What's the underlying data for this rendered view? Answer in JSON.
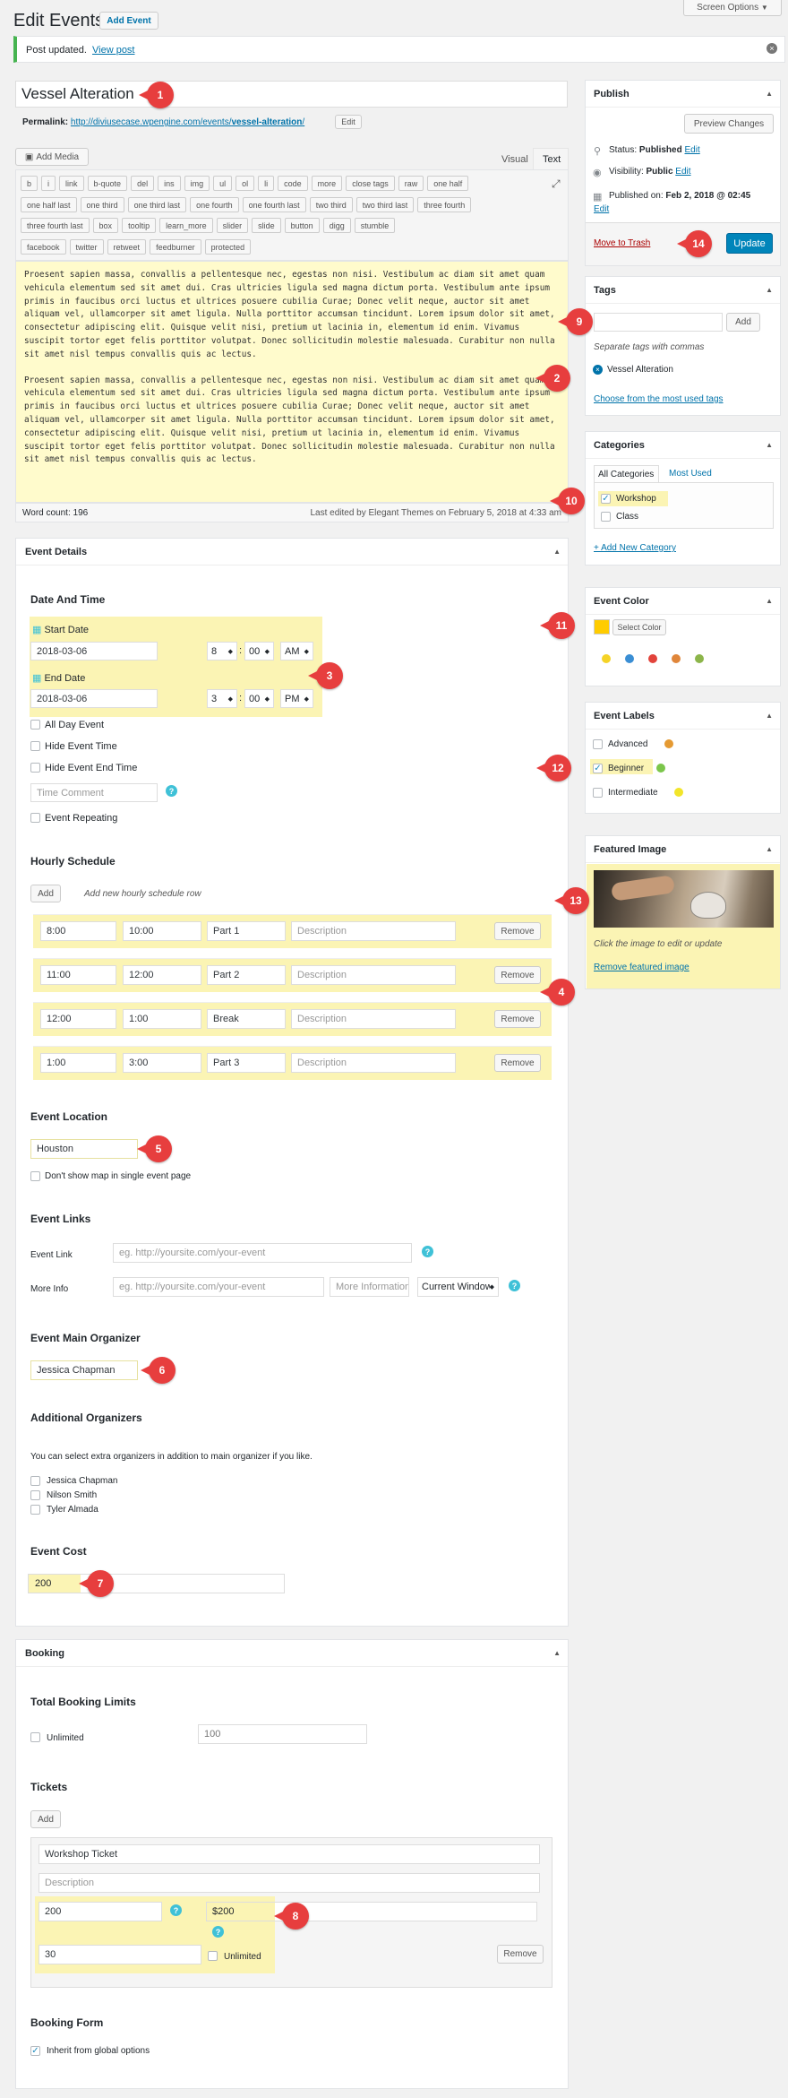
{
  "header": {
    "title": "Edit Events",
    "add_button": "Add Event",
    "screen_options": "Screen Options"
  },
  "notice": {
    "text": "Post updated.",
    "link": "View post"
  },
  "post": {
    "title": "Vessel Alteration",
    "permalink_label": "Permalink:",
    "permalink_base": "http://diviusecase.wpengine.com/events/",
    "permalink_slug": "vessel-alteration",
    "permalink_tail": "/",
    "edit": "Edit"
  },
  "editor": {
    "add_media": "Add Media",
    "tab_visual": "Visual",
    "tab_text": "Text",
    "qt_row1": [
      "b",
      "i",
      "link",
      "b-quote",
      "del",
      "ins",
      "img",
      "ul",
      "ol",
      "li",
      "code",
      "more",
      "close tags",
      "raw",
      "one half"
    ],
    "qt_row2": [
      "one half last",
      "one third",
      "one third last",
      "one fourth",
      "one fourth last",
      "two third",
      "two third last",
      "three fourth"
    ],
    "qt_row3": [
      "three fourth last",
      "box",
      "tooltip",
      "learn_more",
      "slider",
      "slide",
      "button",
      "digg",
      "stumble"
    ],
    "qt_row4": [
      "facebook",
      "twitter",
      "retweet",
      "feedburner",
      "protected"
    ],
    "para1": "Proesent sapien massa, convallis a pellentesque nec, egestas non nisi. Vestibulum ac diam sit amet quam vehicula elementum sed sit amet dui. Cras ultricies ligula sed magna dictum porta. Vestibulum ante ipsum primis in faucibus orci luctus et ultrices posuere cubilia Curae; Donec velit neque, auctor sit amet aliquam vel, ullamcorper sit amet ligula. Nulla porttitor accumsan tincidunt. Lorem ipsum dolor sit amet, consectetur adipiscing elit. Quisque velit nisi, pretium ut lacinia in, elementum id enim. Vivamus suscipit tortor eget felis porttitor volutpat. Donec sollicitudin molestie malesuada. Curabitur non nulla sit amet nisl tempus convallis quis ac lectus.",
    "para2": "Proesent sapien massa, convallis a pellentesque nec, egestas non nisi. Vestibulum ac diam sit amet quam vehicula elementum sed sit amet dui. Cras ultricies ligula sed magna dictum porta. Vestibulum ante ipsum primis in faucibus orci luctus et ultrices posuere cubilia Curae; Donec velit neque, auctor sit amet aliquam vel, ullamcorper sit amet ligula. Nulla porttitor accumsan tincidunt. Lorem ipsum dolor sit amet, consectetur adipiscing elit. Quisque velit nisi, pretium ut lacinia in, elementum id enim. Vivamus suscipit tortor eget felis porttitor volutpat. Donec sollicitudin molestie malesuada. Curabitur non nulla sit amet nisl tempus convallis quis ac lectus.",
    "word_count": "Word count: 196",
    "last_edited": "Last edited by Elegant Themes on February 5, 2018 at 4:33 am"
  },
  "event": {
    "title": "Event Details",
    "dt_heading": "Date And Time",
    "start_label": "Start Date",
    "start_date": "2018-03-06",
    "start_hour": "8",
    "start_min": "00",
    "start_ampm": "AM",
    "end_label": "End Date",
    "end_date": "2018-03-06",
    "end_hour": "3",
    "end_min": "00",
    "end_ampm": "PM",
    "colon": ":",
    "all_day": "All Day Event",
    "hide_time": "Hide Event Time",
    "hide_end": "Hide Event End Time",
    "time_comment": "Time Comment",
    "repeating": "Event Repeating",
    "help": "?"
  },
  "hourly": {
    "heading": "Hourly Schedule",
    "add": "Add",
    "hint": "Add new hourly schedule row",
    "desc_ph": "Description",
    "remove": "Remove",
    "rows": [
      {
        "from": "8:00",
        "to": "10:00",
        "title": "Part 1"
      },
      {
        "from": "11:00",
        "to": "12:00",
        "title": "Part 2"
      },
      {
        "from": "12:00",
        "to": "1:00",
        "title": "Break"
      },
      {
        "from": "1:00",
        "to": "3:00",
        "title": "Part 3"
      }
    ]
  },
  "location": {
    "heading": "Event Location",
    "value": "Houston",
    "no_map": "Don't show map in single event page"
  },
  "links": {
    "heading": "Event Links",
    "link_label": "Event Link",
    "link_ph": "eg. http://yoursite.com/your-event",
    "more_label": "More Info",
    "more_ph": "eg. http://yoursite.com/your-event",
    "more_text_ph": "More Information",
    "target": "Current Window"
  },
  "organizer": {
    "heading": "Event Main Organizer",
    "value": "Jessica Chapman",
    "additional_heading": "Additional Organizers",
    "additional_hint": "You can select extra organizers in addition to main organizer if you like.",
    "list": [
      "Jessica Chapman",
      "Nilson Smith",
      "Tyler Almada"
    ]
  },
  "cost": {
    "heading": "Event Cost",
    "value": "200"
  },
  "booking": {
    "title": "Booking",
    "limits_heading": "Total Booking Limits",
    "unlimited": "Unlimited",
    "limit_value": "100",
    "tickets_heading": "Tickets",
    "add": "Add",
    "ticket_name": "Workshop Ticket",
    "ticket_desc_ph": "Description",
    "ticket_qty": "200",
    "ticket_price": "$200",
    "ticket_limit": "30",
    "ticket_unlimited": "Unlimited",
    "remove": "Remove",
    "form_heading": "Booking Form",
    "inherit": "Inherit from global options"
  },
  "publish": {
    "title": "Publish",
    "preview": "Preview Changes",
    "status_label": "Status:",
    "status_value": "Published",
    "visibility_label": "Visibility:",
    "visibility_value": "Public",
    "published_label": "Published on:",
    "published_value": "Feb 2, 2018 @ 02:45",
    "edit": "Edit",
    "trash": "Move to Trash",
    "update": "Update"
  },
  "tags": {
    "title": "Tags",
    "add": "Add",
    "hint": "Separate tags with commas",
    "tag": "Vessel Alteration",
    "choose": "Choose from the most used tags"
  },
  "categories": {
    "title": "Categories",
    "tab_all": "All Categories",
    "tab_most": "Most Used",
    "items": [
      "Workshop",
      "Class"
    ],
    "add_new": "+ Add New Category"
  },
  "color": {
    "title": "Event Color",
    "select": "Select Color",
    "selected": "#ffcc00",
    "swatches": [
      "#f5d327",
      "#3a8ed4",
      "#e2433b",
      "#e0863a",
      "#8cb54a"
    ]
  },
  "labels": {
    "title": "Event Labels",
    "items": [
      {
        "name": "Advanced",
        "color": "#e59a32"
      },
      {
        "name": "Beginner",
        "color": "#7bc64b"
      },
      {
        "name": "Intermediate",
        "color": "#f2e52a"
      }
    ]
  },
  "featured": {
    "title": "Featured Image",
    "hint": "Click the image to edit or update",
    "remove": "Remove featured image"
  },
  "markers": [
    "1",
    "2",
    "3",
    "4",
    "5",
    "6",
    "7",
    "8",
    "9",
    "10",
    "11",
    "12",
    "13",
    "14"
  ]
}
